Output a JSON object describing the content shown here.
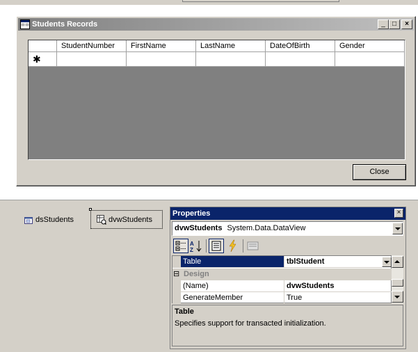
{
  "form": {
    "title": "Students Records",
    "columns": [
      "StudentNumber",
      "FirstName",
      "LastName",
      "DateOfBirth",
      "Gender"
    ],
    "new_row_marker": "✱",
    "close_label": "Close",
    "title_buttons": {
      "minimize": "_",
      "maximize": "□",
      "close": "×"
    }
  },
  "tray": {
    "items": [
      {
        "label": "dsStudents",
        "icon": "dataset-icon"
      },
      {
        "label": "dvwStudents",
        "icon": "dataview-icon"
      }
    ]
  },
  "properties": {
    "title": "Properties",
    "close": "×",
    "object_name": "dvwStudents",
    "object_type": "System.Data.DataView",
    "rows": [
      {
        "name": "Table",
        "value": "tblStudent",
        "selected": true
      },
      {
        "category": "Design",
        "expander": "⊟"
      },
      {
        "name": "(Name)",
        "value": "dvwStudents"
      },
      {
        "name": "GenerateMember",
        "value": "True"
      }
    ],
    "desc_title": "Table",
    "desc_text": "Specifies support for transacted initialization."
  },
  "colors": {
    "titlebar_inactive": "#808080",
    "selection": "#0a246a",
    "grid_bg": "#808080"
  }
}
